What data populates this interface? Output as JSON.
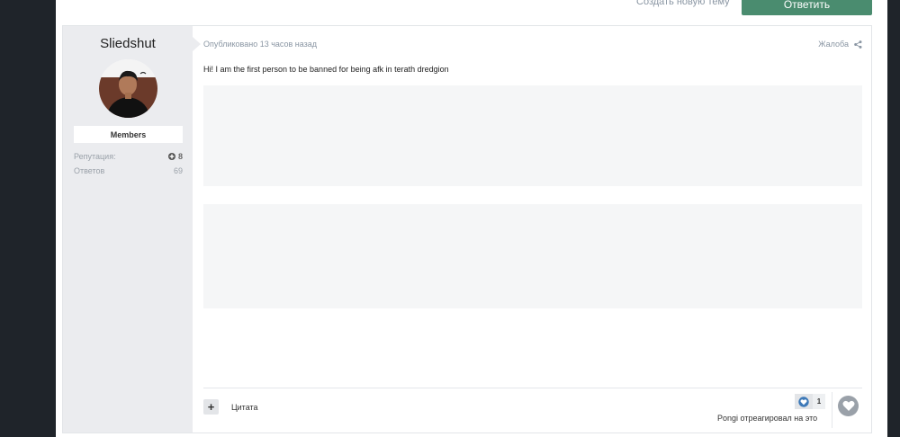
{
  "topbar": {
    "new_topic_label": "Создать новую тему",
    "reply_label": "Ответить"
  },
  "author": {
    "name": "Sliedshut",
    "group": "Members",
    "stats": [
      {
        "label": "Репутация:",
        "value": "8"
      },
      {
        "label": "Ответов",
        "value": "69"
      }
    ]
  },
  "post": {
    "meta": "Опубликовано 13 часов назад",
    "report_label": "Жалоба",
    "text": "Hi! I am the first person to be banned for being afk in terath dredgion",
    "quote_label": "Цитата",
    "reaction_count": "1",
    "reacted_by": "Pongi отреагировал на это"
  },
  "colors": {
    "accent": "#4a8c6f",
    "author_panel": "#ebecef",
    "page_bg": "#1f242a"
  }
}
